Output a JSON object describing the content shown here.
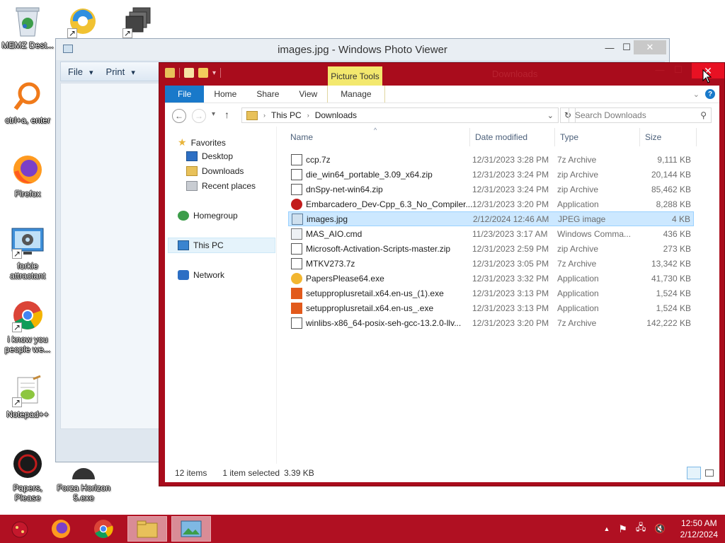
{
  "desktop": {
    "icons": [
      {
        "label": "MEMZ Dest...",
        "icon": "recycle-bin-icon"
      },
      {
        "label": "ctrl+a, enter",
        "icon": "magnifier-icon"
      },
      {
        "label": "Firefox",
        "icon": "firefox-icon"
      },
      {
        "label": "forkie attractant",
        "icon": "computer-settings-icon"
      },
      {
        "label": "i know you people we...",
        "icon": "chrome-icon"
      },
      {
        "label": "Notepad++",
        "icon": "notepadpp-icon"
      },
      {
        "label": "Papers, Please",
        "icon": "papers-please-icon"
      },
      {
        "label": "Forza Horizon 5.exe",
        "icon": "app-icon"
      }
    ]
  },
  "photo_viewer": {
    "title": "images.jpg - Windows Photo Viewer",
    "menu": {
      "file": "File",
      "print": "Print"
    }
  },
  "explorer": {
    "context_tab": "Picture Tools",
    "title": "Downloads",
    "tabs": {
      "file": "File",
      "home": "Home",
      "share": "Share",
      "view": "View",
      "manage": "Manage"
    },
    "breadcrumb": {
      "root": "This PC",
      "current": "Downloads"
    },
    "search_placeholder": "Search Downloads",
    "nav": {
      "favorites": "Favorites",
      "desktop": "Desktop",
      "downloads": "Downloads",
      "recent": "Recent places",
      "homegroup": "Homegroup",
      "thispc": "This PC",
      "network": "Network"
    },
    "columns": {
      "name": "Name",
      "date": "Date modified",
      "type": "Type",
      "size": "Size"
    },
    "files": [
      {
        "name": "ccp.7z",
        "date": "12/31/2023 3:28 PM",
        "type": "7z Archive",
        "size": "9,111 KB",
        "icon": "archive-icon",
        "selected": false
      },
      {
        "name": "die_win64_portable_3.09_x64.zip",
        "date": "12/31/2023 3:24 PM",
        "type": "zip Archive",
        "size": "20,144 KB",
        "icon": "archive-icon",
        "selected": false
      },
      {
        "name": "dnSpy-net-win64.zip",
        "date": "12/31/2023 3:24 PM",
        "type": "zip Archive",
        "size": "85,462 KB",
        "icon": "archive-icon",
        "selected": false
      },
      {
        "name": "Embarcadero_Dev-Cpp_6.3_No_Compiler...",
        "date": "12/31/2023 3:20 PM",
        "type": "Application",
        "size": "8,288 KB",
        "icon": "devcpp-icon",
        "selected": false
      },
      {
        "name": "images.jpg",
        "date": "2/12/2024 12:46 AM",
        "type": "JPEG image",
        "size": "4 KB",
        "icon": "image-file-icon",
        "selected": true
      },
      {
        "name": "MAS_AIO.cmd",
        "date": "11/23/2023 3:17 AM",
        "type": "Windows Comma...",
        "size": "436 KB",
        "icon": "cmd-file-icon",
        "selected": false
      },
      {
        "name": "Microsoft-Activation-Scripts-master.zip",
        "date": "12/31/2023 2:59 PM",
        "type": "zip Archive",
        "size": "273 KB",
        "icon": "archive-icon",
        "selected": false
      },
      {
        "name": "MTKV273.7z",
        "date": "12/31/2023 3:05 PM",
        "type": "7z Archive",
        "size": "13,342 KB",
        "icon": "archive-icon",
        "selected": false
      },
      {
        "name": "PapersPlease64.exe",
        "date": "12/31/2023 3:32 PM",
        "type": "Application",
        "size": "41,730 KB",
        "icon": "papers-exe-icon",
        "selected": false
      },
      {
        "name": "setupproplusretail.x64.en-us_(1).exe",
        "date": "12/31/2023 3:13 PM",
        "type": "Application",
        "size": "1,524 KB",
        "icon": "office-icon",
        "selected": false
      },
      {
        "name": "setupproplusretail.x64.en-us_.exe",
        "date": "12/31/2023 3:13 PM",
        "type": "Application",
        "size": "1,524 KB",
        "icon": "office-icon",
        "selected": false
      },
      {
        "name": "winlibs-x86_64-posix-seh-gcc-13.2.0-llv...",
        "date": "12/31/2023 3:20 PM",
        "type": "7z Archive",
        "size": "142,222 KB",
        "icon": "archive-icon",
        "selected": false
      }
    ],
    "status": {
      "items": "12 items",
      "selected": "1 item selected",
      "size": "3.39 KB"
    }
  },
  "taskbar": {
    "time": "12:50 AM",
    "date": "2/12/2024"
  },
  "colors": {
    "explorer_frame": "#a90c1c",
    "taskbar": "#b01022",
    "picture_tools": "#f3e86e",
    "file_tab": "#1979ca",
    "selection": "#cce8ff"
  }
}
